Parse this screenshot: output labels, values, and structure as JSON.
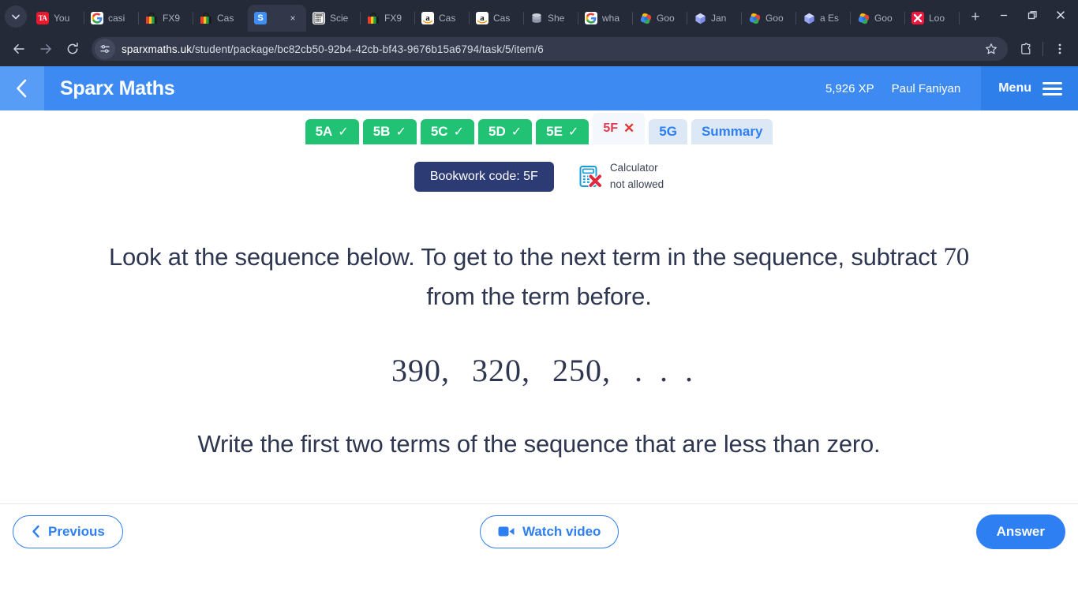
{
  "browser": {
    "tabs": [
      {
        "title": "You",
        "icon": "tiktok-ads-icon",
        "icon_kind": "ta",
        "active": false
      },
      {
        "title": "casi",
        "icon": "google-icon",
        "icon_kind": "google",
        "active": false
      },
      {
        "title": "FX9",
        "icon": "shopping-bag-icon",
        "icon_kind": "bag",
        "active": false
      },
      {
        "title": "Cas",
        "icon": "shopping-bag-icon",
        "icon_kind": "bag",
        "active": false
      },
      {
        "title": "",
        "icon": "sparx-icon",
        "icon_kind": "sparx",
        "active": true
      },
      {
        "title": "Scie",
        "icon": "calculator-icon",
        "icon_kind": "calc",
        "active": false
      },
      {
        "title": "FX9",
        "icon": "shopping-bag-icon",
        "icon_kind": "bag",
        "active": false
      },
      {
        "title": "Cas",
        "icon": "amazon-icon",
        "icon_kind": "amazon",
        "active": false
      },
      {
        "title": "Cas",
        "icon": "amazon-icon",
        "icon_kind": "amazon",
        "active": false
      },
      {
        "title": "She",
        "icon": "database-icon",
        "icon_kind": "db",
        "active": false
      },
      {
        "title": "wha",
        "icon": "google-icon",
        "icon_kind": "google",
        "active": false
      },
      {
        "title": "Goo",
        "icon": "google-photos-icon",
        "icon_kind": "gphotos",
        "active": false
      },
      {
        "title": "Jan",
        "icon": "cube-icon",
        "icon_kind": "cube",
        "active": false
      },
      {
        "title": "Goo",
        "icon": "google-photos-icon",
        "icon_kind": "gphotos",
        "active": false
      },
      {
        "title": "a Es",
        "icon": "cube-icon",
        "icon_kind": "cube",
        "active": false
      },
      {
        "title": "Goo",
        "icon": "google-photos-icon",
        "icon_kind": "gphotos",
        "active": false
      },
      {
        "title": "Loo",
        "icon": "lockdown-icon",
        "icon_kind": "lock",
        "active": false
      }
    ],
    "new_tab_label": "+",
    "close_tab_label": "×",
    "url_host": "sparxmaths.uk",
    "url_path": "/student/package/bc82cb50-92b4-42cb-bf43-9676b15a6794/task/5/item/6",
    "window": {
      "minimize": "—",
      "restore": "❐",
      "close": "✕"
    }
  },
  "app_header": {
    "brand": "Sparx Maths",
    "xp": "5,926 XP",
    "user": "Paul Faniyan",
    "menu_label": "Menu",
    "accent_color": "#3d8bf2"
  },
  "task_tabs": [
    {
      "label": "5A",
      "state": "done",
      "mark": "✓"
    },
    {
      "label": "5B",
      "state": "done",
      "mark": "✓"
    },
    {
      "label": "5C",
      "state": "done",
      "mark": "✓"
    },
    {
      "label": "5D",
      "state": "done",
      "mark": "✓"
    },
    {
      "label": "5E",
      "state": "done",
      "mark": "✓"
    },
    {
      "label": "5F",
      "state": "current",
      "mark": "✕"
    },
    {
      "label": "5G",
      "state": "upcoming",
      "mark": ""
    },
    {
      "label": "Summary",
      "state": "upcoming",
      "mark": ""
    }
  ],
  "meta": {
    "bookwork_code": "Bookwork code: 5F",
    "calculator_line1": "Calculator",
    "calculator_line2": "not allowed"
  },
  "question": {
    "intro_before": "Look at the sequence below. To get to the next term in the sequence, subtract ",
    "intro_number": "70",
    "intro_after": " from the term before.",
    "sequence_terms": [
      "390,",
      "320,",
      "250,"
    ],
    "sequence_ellipsis": ". . .",
    "prompt": "Write the first two terms of the sequence that are less than zero."
  },
  "footer": {
    "previous_label": "Previous",
    "watch_video_label": "Watch video",
    "answer_label": "Answer"
  },
  "colors": {
    "sparx_blue": "#3d8bf2",
    "green": "#22c275",
    "red": "#e13b4f",
    "navy": "#2c3b74"
  }
}
